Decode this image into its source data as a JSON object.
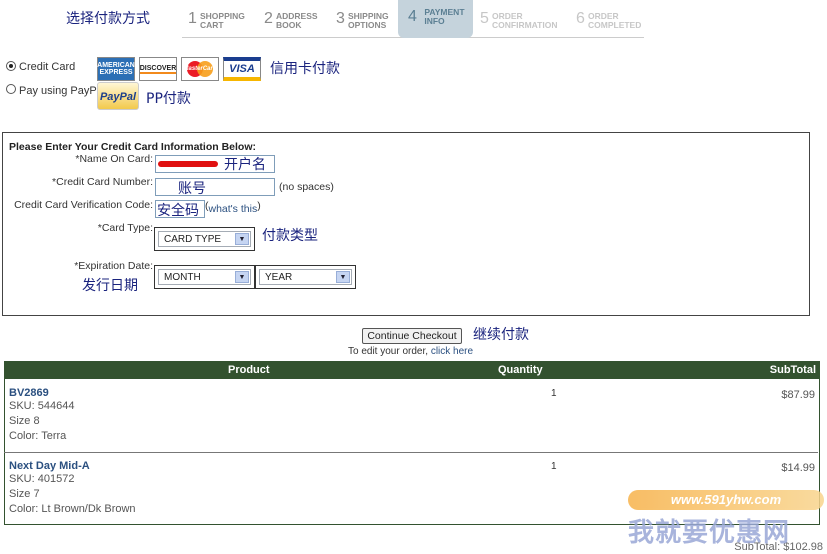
{
  "annotations": {
    "title": "选择付款方式",
    "credit_card": "信用卡付款",
    "paypal": "PP付款",
    "name_on_card": "开户名",
    "card_number": "账号",
    "verification": "安全码",
    "card_type": "付款类型",
    "expiration": "发行日期",
    "continue": "继续付款"
  },
  "steps": [
    {
      "num": "1",
      "label": "SHOPPING\nCART"
    },
    {
      "num": "2",
      "label": "ADDRESS\nBOOK"
    },
    {
      "num": "3",
      "label": "SHIPPING\nOPTIONS"
    },
    {
      "num": "4",
      "label": "PAYMENT\nINFO"
    },
    {
      "num": "5",
      "label": "ORDER\nCONFIRMATION"
    },
    {
      "num": "6",
      "label": "ORDER\nCOMPLETED"
    }
  ],
  "payment": {
    "credit_card_label": "Credit Card",
    "paypal_label": "Pay using PayPal",
    "cards": [
      "AMERICAN EXPRESS",
      "DISCOVER",
      "MasterCard",
      "VISA"
    ],
    "paypal_logo": "PayPal"
  },
  "form": {
    "heading": "Please Enter Your Credit Card Information Below:",
    "name_label": "*Name On Card:",
    "number_label": "*Credit Card Number:",
    "number_hint": "(no spaces)",
    "cvv_label": "Credit Card Verification Code:",
    "cvv_paren_open": "(",
    "cvv_link": "what's this",
    "cvv_paren_close": ")",
    "type_label": "*Card Type:",
    "type_value": "CARD TYPE",
    "exp_label": "*Expiration Date:",
    "month_value": "MONTH",
    "year_value": "YEAR"
  },
  "actions": {
    "continue_label": "Continue Checkout",
    "edit_prefix": "To edit your order,",
    "edit_link": "click here"
  },
  "table": {
    "headers": {
      "product": "Product",
      "quantity": "Quantity",
      "subtotal": "SubTotal"
    },
    "rows": [
      {
        "name": "BV2869",
        "sku": "SKU: 544644",
        "size": "Size 8",
        "color": "Color: Terra",
        "qty": "1",
        "subtotal": "$87.99"
      },
      {
        "name": "Next Day Mid-A",
        "sku": "SKU: 401572",
        "size": "Size 7",
        "color": "Color: Lt Brown/Dk Brown",
        "qty": "1",
        "subtotal": "$14.99"
      }
    ],
    "total_label": "SubTotal:",
    "total_value": "$102.98"
  },
  "watermark": {
    "url": "www.591yhw.com",
    "text": "我就要优惠网"
  },
  "colors": {
    "table_header": "#33522f",
    "link": "#2b5080",
    "active_step": "#c5d3dc",
    "annotation": "#1a237e",
    "redaction": "#e01010"
  }
}
